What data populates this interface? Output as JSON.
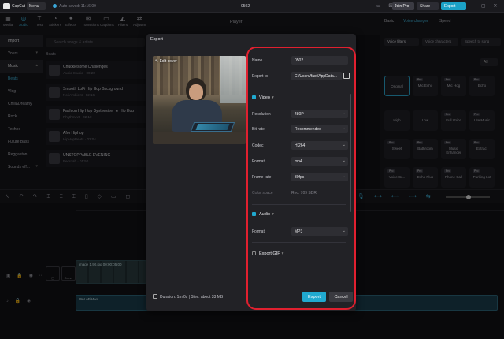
{
  "topbar": {
    "app_name": "CapCut",
    "menu_label": "Menu",
    "autosave": "Auto saved: 11:16:09",
    "doc_title": "0502",
    "join_pro": "Join Pro",
    "share": "Share",
    "export": "Export"
  },
  "tools": [
    {
      "label": "Media",
      "icon": "▦"
    },
    {
      "label": "Audio",
      "icon": "◎"
    },
    {
      "label": "Text",
      "icon": "T"
    },
    {
      "label": "Stickers",
      "icon": "◔"
    },
    {
      "label": "Effects",
      "icon": "✦"
    },
    {
      "label": "Transitions",
      "icon": "⊠"
    },
    {
      "label": "Captions",
      "icon": "▭"
    },
    {
      "label": "Filters",
      "icon": "◭"
    },
    {
      "label": "Adjustment",
      "icon": "⇄"
    }
  ],
  "sidebar": {
    "items": [
      {
        "label": "Import"
      },
      {
        "label": "Yours"
      },
      {
        "label": "Music"
      },
      {
        "label": "Beats"
      },
      {
        "label": "Vlog"
      },
      {
        "label": "Chill&Dreamy"
      },
      {
        "label": "Rock"
      },
      {
        "label": "Techno"
      },
      {
        "label": "Future Bass"
      },
      {
        "label": "Reggaeton"
      },
      {
        "label": "Sounds eff..."
      }
    ]
  },
  "audio_panel": {
    "search_placeholder": "Search songs & artists",
    "section": "Beats",
    "tracks": [
      {
        "title": "Chucklesome Challenges",
        "subtitle": "Audio Studio · 00:20"
      },
      {
        "title": "Smooth LoFi Hip Hop Background",
        "subtitle": "NoirAmbient · 02:16"
      },
      {
        "title": "Fashion Hip Hop Synthesizer ★ Hip Hop",
        "subtitle": "RhythmArt · 02:10"
      },
      {
        "title": "Afro Hiphop",
        "subtitle": "HipHopBeats · 02:04"
      },
      {
        "title": "UNSTOPPABLE EVENING",
        "subtitle": "Pedroah · 01:50"
      }
    ]
  },
  "player": {
    "label": "Player"
  },
  "right_panel": {
    "tabs": [
      "Basic",
      "Voice changer",
      "Speed"
    ],
    "subtabs": [
      "Voice filters",
      "Voice characters",
      "Speech to song"
    ],
    "all_label": "All",
    "voices": [
      {
        "label": "Original",
        "pro": false
      },
      {
        "label": "Mic Echo",
        "pro": true
      },
      {
        "label": "Mic Hog",
        "pro": true
      },
      {
        "label": "Echo",
        "pro": true
      },
      {
        "label": "High",
        "pro": false
      },
      {
        "label": "Low",
        "pro": false
      },
      {
        "label": "Full Voice",
        "pro": true
      },
      {
        "label": "Lite Music",
        "pro": true
      },
      {
        "label": "Sweet",
        "pro": true
      },
      {
        "label": "Bathroom",
        "pro": true
      },
      {
        "label": "Music Enhancer",
        "pro": true
      },
      {
        "label": "Extract",
        "pro": true
      },
      {
        "label": "Voice Cr...",
        "pro": true
      },
      {
        "label": "Echo Plus",
        "pro": true
      },
      {
        "label": "Phone Call",
        "pro": true
      },
      {
        "label": "Parking Lot",
        "pro": true
      }
    ],
    "pro_badge": "Pro"
  },
  "timeline": {
    "cover_label": "Cover",
    "image_clip": "image 1.90.jpg  00:00:05:00",
    "audio_clip": "WeLoFiMool"
  },
  "export_dialog": {
    "title": "Export",
    "edit_cover": "Edit cover",
    "name_label": "Name",
    "name_value": "0502",
    "export_to_label": "Export to",
    "export_to_value": "C:/Users/fast/AppData...",
    "video_section": "Video",
    "resolution_label": "Resolution",
    "resolution_value": "480P",
    "bitrate_label": "Bit rate",
    "bitrate_value": "Recommended",
    "codec_label": "Codec",
    "codec_value": "H.264",
    "format_label": "Format",
    "format_value": "mp4",
    "framerate_label": "Frame rate",
    "framerate_value": "30fps",
    "colorspace_label": "Color space",
    "colorspace_value": "Rec. 709 SDR",
    "audio_section": "Audio",
    "audio_format_label": "Format",
    "audio_format_value": "MP3",
    "gif_section": "Export GIF",
    "duration": "Duration: 1m 0s | Size: about 33 MB",
    "export_button": "Export",
    "cancel_button": "Cancel"
  },
  "colors": {
    "accent": "#20a9cf",
    "highlight": "#e0202f",
    "dialog_bg": "#222226"
  }
}
